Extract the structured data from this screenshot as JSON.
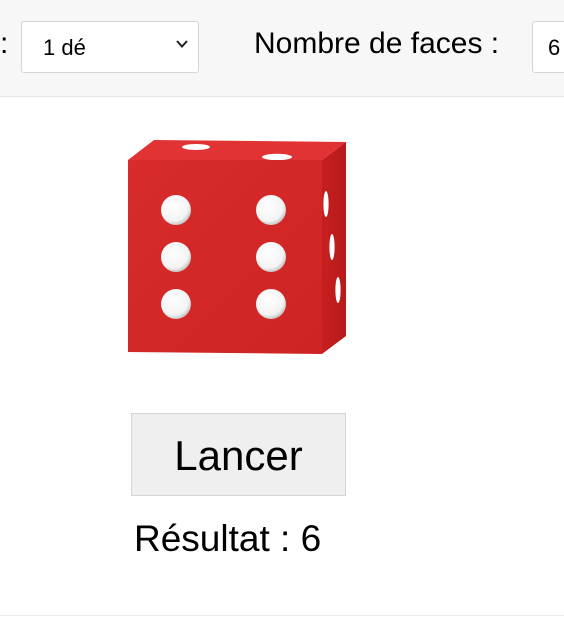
{
  "toolbar": {
    "leading_colon": ":",
    "dice_count": {
      "selected": "1 dé"
    },
    "faces": {
      "label": "Nombre de faces :",
      "selected": "6"
    }
  },
  "die": {
    "front_face_value": 6,
    "color": "#d62a2a",
    "pip_color": "#ffffff"
  },
  "actions": {
    "roll_label": "Lancer"
  },
  "result": {
    "label": "Résultat :",
    "value": "6"
  },
  "icons": {
    "select_arrow": "chevron-down-icon"
  }
}
